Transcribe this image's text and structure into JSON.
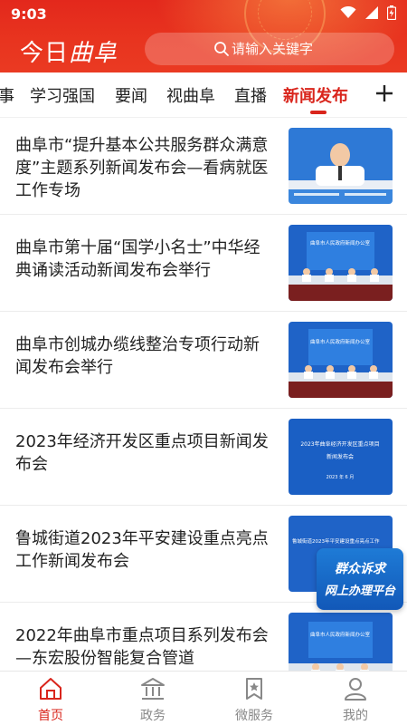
{
  "status_bar": {
    "time": "9:03"
  },
  "header": {
    "logo_prefix": "今日",
    "logo_script": "曲阜",
    "search_placeholder": "请输入关键字",
    "brand_color": "#e8341f"
  },
  "tabs": [
    {
      "label": "事",
      "active": false
    },
    {
      "label": "学习强国",
      "active": false
    },
    {
      "label": "要闻",
      "active": false
    },
    {
      "label": "视曲阜",
      "active": false
    },
    {
      "label": "直播",
      "active": false
    },
    {
      "label": "新闻发布",
      "active": true
    }
  ],
  "news": [
    {
      "title": "曲阜市“提升基本公共服务群众满意度”主题系列新闻发布会—看病就医工作专场",
      "thumb_caption": ""
    },
    {
      "title": "曲阜市第十届“国学小名士”中华经典诵读活动新闻发布会举行",
      "thumb_caption": "曲阜市人民政府新闻办公室"
    },
    {
      "title": "曲阜市创城办缆线整治专项行动新闻发布会举行",
      "thumb_caption": "曲阜市人民政府新闻办公室"
    },
    {
      "title": "2023年经济开发区重点项目新闻发布会",
      "thumb_caption": "2023年曲阜经济开发区重点项目",
      "thumb_caption2": "新闻发布会",
      "thumb_date": "2023 年 6 月"
    },
    {
      "title": "鲁城街道2023年平安建设重点亮点工作新闻发布会",
      "thumb_caption": "鲁城街道2023年平安建设重点亮点工作"
    },
    {
      "title": "2022年曲阜市重点项目系列发布会 —东宏股份智能复合管道",
      "thumb_caption": "曲阜市人民政府新闻办公室"
    }
  ],
  "float_banner": {
    "line1": "群众诉求",
    "line2": "网上办理平台"
  },
  "bottom_nav": [
    {
      "label": "首页",
      "icon": "home-icon",
      "active": true
    },
    {
      "label": "政务",
      "icon": "government-building-icon",
      "active": false
    },
    {
      "label": "微服务",
      "icon": "bookmark-star-icon",
      "active": false
    },
    {
      "label": "我的",
      "icon": "user-icon",
      "active": false
    }
  ],
  "colors": {
    "accent": "#d9251c",
    "inactive": "#888888",
    "thumb_blue": "#1f63c7"
  }
}
